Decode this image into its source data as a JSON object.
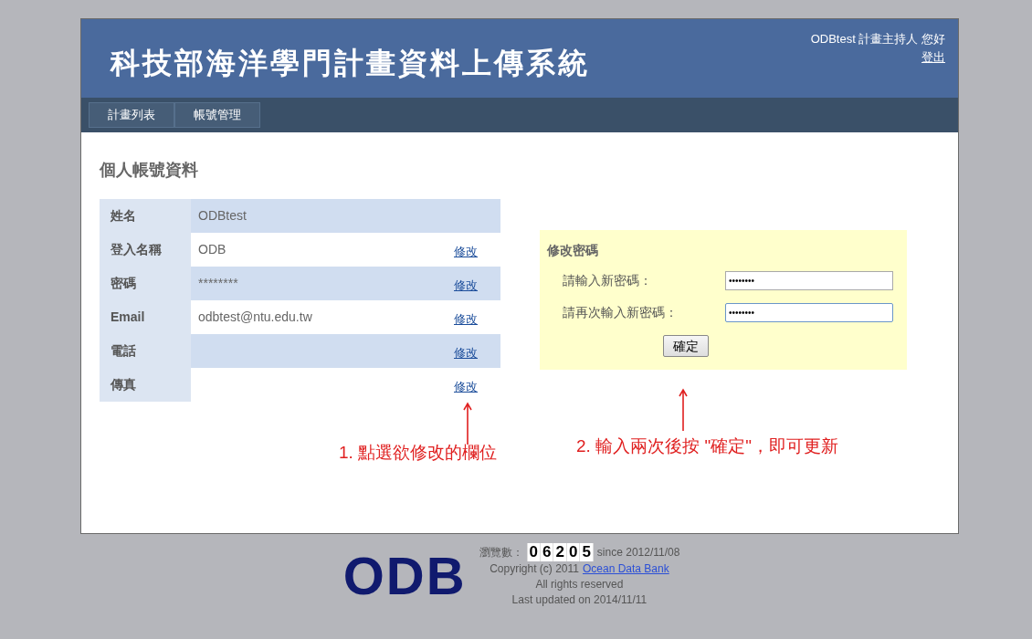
{
  "header": {
    "title": "科技部海洋學門計畫資料上傳系統",
    "greeting": "ODBtest 計畫主持人 您好",
    "logout": "登出"
  },
  "nav": [
    {
      "label": "計畫列表"
    },
    {
      "label": "帳號管理"
    }
  ],
  "section_title": "個人帳號資料",
  "profile_rows": [
    {
      "label": "姓名",
      "value": "ODBtest"
    },
    {
      "label": "登入名稱",
      "value": "ODB",
      "edit": "修改"
    },
    {
      "label": "密碼",
      "value": "********",
      "edit": "修改"
    },
    {
      "label": "Email",
      "value": "odbtest@ntu.edu.tw",
      "edit": "修改"
    },
    {
      "label": "電話",
      "value": "",
      "edit": "修改"
    },
    {
      "label": "傳真",
      "value": "",
      "edit": "修改"
    }
  ],
  "password_panel": {
    "title": "修改密碼",
    "fields": [
      {
        "label": "請輸入新密碼：",
        "value": "••••••••",
        "focused": false
      },
      {
        "label": "請再次輸入新密碼：",
        "value": "••••••••",
        "focused": true
      }
    ],
    "confirm": "確定"
  },
  "annotations": [
    "1. 點選欲修改的欄位",
    "2. 輸入兩次後按 \"確定\"，即可更新"
  ],
  "footer": {
    "logo": "ODB",
    "counter_label": "瀏覽數：",
    "counter_digits": [
      "0",
      "6",
      "2",
      "0",
      "5"
    ],
    "since": "since 2012/11/08",
    "copyright": "Copyright (c) 2011",
    "link": "Ocean Data Bank",
    "rights": "All rights reserved",
    "updated": "Last updated on 2014/11/11"
  }
}
